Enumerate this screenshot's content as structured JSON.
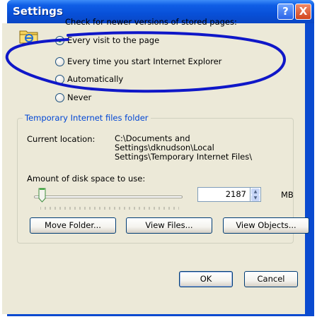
{
  "window": {
    "title": "Settings"
  },
  "titlebar": {
    "help_glyph": "?",
    "close_glyph": "X"
  },
  "check_newer": {
    "heading": "Check for newer versions of stored pages:",
    "options": [
      {
        "label": "Every visit to the page",
        "checked": true
      },
      {
        "label": "Every time you start Internet Explorer",
        "checked": false
      },
      {
        "label": "Automatically",
        "checked": false
      },
      {
        "label": "Never",
        "checked": false
      }
    ]
  },
  "temp_files": {
    "group_title": "Temporary Internet files folder",
    "location_label": "Current location:",
    "location_value": "C:\\Documents and Settings\\dknudson\\Local Settings\\Temporary Internet Files\\",
    "disk_label": "Amount of disk space to use:",
    "disk_value": "2187",
    "disk_unit": "MB",
    "buttons": {
      "move": "Move Folder...",
      "view_files": "View Files...",
      "view_objects": "View Objects..."
    }
  },
  "footer": {
    "ok": "OK",
    "cancel": "Cancel"
  },
  "colors": {
    "titlebar": "#0a4ad0",
    "dialog_bg": "#ece9d8",
    "group_title": "#0046d5",
    "annotation": "#0f17c8"
  }
}
